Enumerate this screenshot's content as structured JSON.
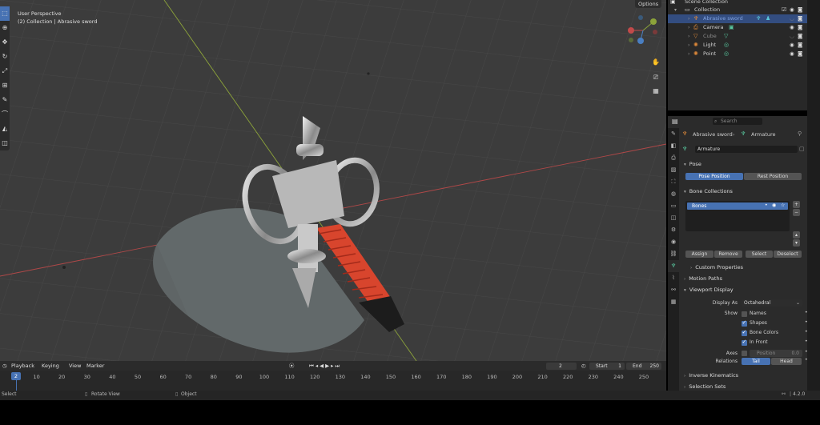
{
  "viewport": {
    "view_name": "User Perspective",
    "context": "(2) Collection | Abrasive sword",
    "options_label": "Options",
    "tools": [
      "select-box-icon",
      "cursor-icon",
      "move-icon",
      "rotate-icon",
      "scale-icon",
      "transform-icon",
      "annotate-icon",
      "measure-icon",
      "roll-icon",
      "extrude-icon"
    ]
  },
  "outliner": {
    "items": [
      {
        "label": "Scene Collection",
        "type": "scene"
      },
      {
        "label": "Collection",
        "type": "collection"
      },
      {
        "label": "Abrasive sword",
        "type": "armature",
        "selected": true
      },
      {
        "label": "Camera",
        "type": "camera"
      },
      {
        "label": "Cube",
        "type": "mesh"
      },
      {
        "label": "Light",
        "type": "light"
      },
      {
        "label": "Point",
        "type": "light"
      }
    ]
  },
  "properties": {
    "search_placeholder": "Search",
    "breadcrumb_object": "Abrasive sword",
    "breadcrumb_data": "Armature",
    "data_name": "Armature",
    "pose_header": "Pose",
    "pose_position": "Pose Position",
    "rest_position": "Rest Position",
    "bone_collections_header": "Bone Collections",
    "bone_collection_item": "Bones",
    "assign": "Assign",
    "remove": "Remove",
    "select": "Select",
    "deselect": "Deselect",
    "custom_properties": "Custom Properties",
    "motion_paths": "Motion Paths",
    "viewport_display": "Viewport Display",
    "display_as_label": "Display As",
    "display_as_value": "Octahedral",
    "show_label": "Show",
    "names": "Names",
    "shapes": "Shapes",
    "bone_colors": "Bone Colors",
    "in_front": "In Front",
    "axes_label": "Axes",
    "position_label": "Position",
    "position_value": "0.0",
    "relations_label": "Relations",
    "tail": "Tail",
    "head": "Head",
    "inverse_kinematics": "Inverse Kinematics",
    "selection_sets": "Selection Sets"
  },
  "timeline": {
    "playback": "Playback",
    "keying": "Keying",
    "view": "View",
    "marker": "Marker",
    "current_frame": "2",
    "start_label": "Start",
    "start_value": "1",
    "end_label": "End",
    "end_value": "250",
    "ruler": [
      "10",
      "20",
      "30",
      "40",
      "50",
      "60",
      "70",
      "80",
      "90",
      "100",
      "110",
      "120",
      "130",
      "140",
      "150",
      "160",
      "170",
      "180",
      "190",
      "200",
      "210",
      "220",
      "230",
      "240",
      "250"
    ],
    "marker_frame": "2"
  },
  "statusbar": {
    "select": "Select",
    "rotate_view": "Rotate View",
    "object": "Object",
    "version": "4.2.0"
  },
  "colors": {
    "accent": "#4772b3",
    "viewport_bg": "#3c3c3c",
    "x_axis": "#c24a4a",
    "y_axis": "#8ca33a"
  }
}
